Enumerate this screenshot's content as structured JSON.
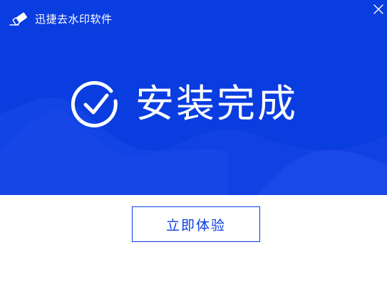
{
  "app": {
    "title": "迅捷去水印软件"
  },
  "status": {
    "title": "安装完成"
  },
  "actions": {
    "experience_label": "立即体验"
  },
  "icons": {
    "logo": "eraser-icon",
    "close": "close-icon",
    "status": "check-circle-icon"
  },
  "colors": {
    "primary": "#0a3de0",
    "button_background": "#ffffff"
  }
}
